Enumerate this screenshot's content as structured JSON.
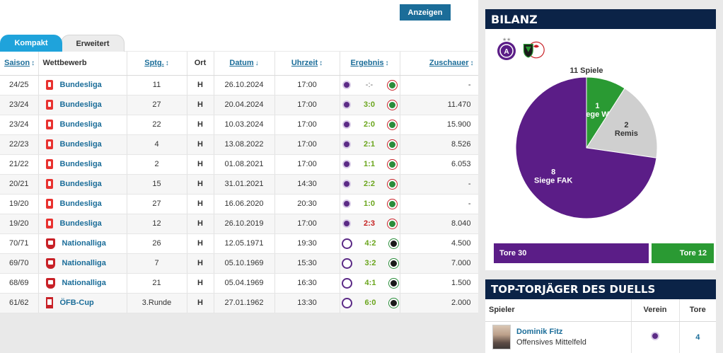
{
  "toolbar": {
    "show_label": "Anzeigen"
  },
  "tabs": [
    {
      "label": "Kompakt",
      "active": true
    },
    {
      "label": "Erweitert",
      "active": false
    }
  ],
  "table": {
    "headers": {
      "saison": "Saison",
      "wettbewerb": "Wettbewerb",
      "spieltag": "Sptg.",
      "ort": "Ort",
      "datum": "Datum",
      "uhrzeit": "Uhrzeit",
      "ergebnis": "Ergebnis",
      "zuschauer": "Zuschauer"
    },
    "sort_arrows": {
      "saison": "↕",
      "spieltag": "↕",
      "datum": "↓",
      "uhrzeit": "↕",
      "ergebnis": "↕",
      "zuschauer": "↕"
    },
    "rows": [
      {
        "saison": "24/25",
        "logo": "bundesliga-logo",
        "wettbewerb": "Bundesliga",
        "spieltag": "11",
        "ort": "H",
        "datum": "26.10.2024",
        "uhrzeit": "17:00",
        "ergebnis": "-:-",
        "result": "none",
        "zuschauer": "-"
      },
      {
        "saison": "23/24",
        "logo": "bundesliga-logo",
        "wettbewerb": "Bundesliga",
        "spieltag": "27",
        "ort": "H",
        "datum": "20.04.2024",
        "uhrzeit": "17:00",
        "ergebnis": "3:0",
        "result": "win",
        "zuschauer": "11.470"
      },
      {
        "saison": "23/24",
        "logo": "bundesliga-logo",
        "wettbewerb": "Bundesliga",
        "spieltag": "22",
        "ort": "H",
        "datum": "10.03.2024",
        "uhrzeit": "17:00",
        "ergebnis": "2:0",
        "result": "win",
        "zuschauer": "15.900"
      },
      {
        "saison": "22/23",
        "logo": "bundesliga-logo",
        "wettbewerb": "Bundesliga",
        "spieltag": "4",
        "ort": "H",
        "datum": "13.08.2022",
        "uhrzeit": "17:00",
        "ergebnis": "2:1",
        "result": "win",
        "zuschauer": "8.526"
      },
      {
        "saison": "21/22",
        "logo": "bundesliga-logo",
        "wettbewerb": "Bundesliga",
        "spieltag": "2",
        "ort": "H",
        "datum": "01.08.2021",
        "uhrzeit": "17:00",
        "ergebnis": "1:1",
        "result": "win",
        "zuschauer": "6.053"
      },
      {
        "saison": "20/21",
        "logo": "bundesliga-logo",
        "wettbewerb": "Bundesliga",
        "spieltag": "15",
        "ort": "H",
        "datum": "31.01.2021",
        "uhrzeit": "14:30",
        "ergebnis": "2:2",
        "result": "win",
        "zuschauer": "-"
      },
      {
        "saison": "19/20",
        "logo": "bundesliga-logo",
        "wettbewerb": "Bundesliga",
        "spieltag": "27",
        "ort": "H",
        "datum": "16.06.2020",
        "uhrzeit": "20:30",
        "ergebnis": "1:0",
        "result": "win",
        "zuschauer": "-"
      },
      {
        "saison": "19/20",
        "logo": "bundesliga-logo",
        "wettbewerb": "Bundesliga",
        "spieltag": "12",
        "ort": "H",
        "datum": "26.10.2019",
        "uhrzeit": "17:00",
        "ergebnis": "2:3",
        "result": "loss",
        "zuschauer": "8.040"
      },
      {
        "saison": "70/71",
        "logo": "nationalliga-logo",
        "wettbewerb": "Nationalliga",
        "spieltag": "26",
        "ort": "H",
        "datum": "12.05.1971",
        "uhrzeit": "19:30",
        "ergebnis": "4:2",
        "result": "win",
        "zuschauer": "4.500"
      },
      {
        "saison": "69/70",
        "logo": "nationalliga-logo",
        "wettbewerb": "Nationalliga",
        "spieltag": "7",
        "ort": "H",
        "datum": "05.10.1969",
        "uhrzeit": "15:30",
        "ergebnis": "3:2",
        "result": "win",
        "zuschauer": "7.000"
      },
      {
        "saison": "68/69",
        "logo": "nationalliga-logo",
        "wettbewerb": "Nationalliga",
        "spieltag": "21",
        "ort": "H",
        "datum": "05.04.1969",
        "uhrzeit": "16:30",
        "ergebnis": "4:1",
        "result": "win",
        "zuschauer": "1.500"
      },
      {
        "saison": "61/62",
        "logo": "cup-logo",
        "wettbewerb": "ÖFB-Cup",
        "spieltag": "3.Runde",
        "ort": "H",
        "datum": "27.01.1962",
        "uhrzeit": "13:30",
        "ergebnis": "6:0",
        "result": "win",
        "zuschauer": "2.000"
      }
    ]
  },
  "bilanz": {
    "title": "BILANZ",
    "colors": {
      "fak": "#5b1d87",
      "ww": "#2a9a33",
      "remis": "#cfcfcf"
    },
    "bar_fak": "Tore 30",
    "bar_ww": "Tore 12"
  },
  "chart_data": {
    "type": "pie",
    "title": "11 Spiele",
    "slices": [
      {
        "count": "1",
        "label": "Siege WW",
        "value": 1,
        "color": "#2a9a33"
      },
      {
        "count": "2",
        "label": "Remis",
        "value": 2,
        "color": "#cfcfcf"
      },
      {
        "count": "8",
        "label": "Siege FAK",
        "value": 8,
        "color": "#5b1d87"
      }
    ]
  },
  "torjaeger": {
    "title": "TOP-TORJÄGER DES DUELLS",
    "headers": {
      "spieler": "Spieler",
      "verein": "Verein",
      "tore": "Tore"
    },
    "player": {
      "name": "Dominik Fitz",
      "position": "Offensives Mittelfeld",
      "tore": "4"
    }
  }
}
